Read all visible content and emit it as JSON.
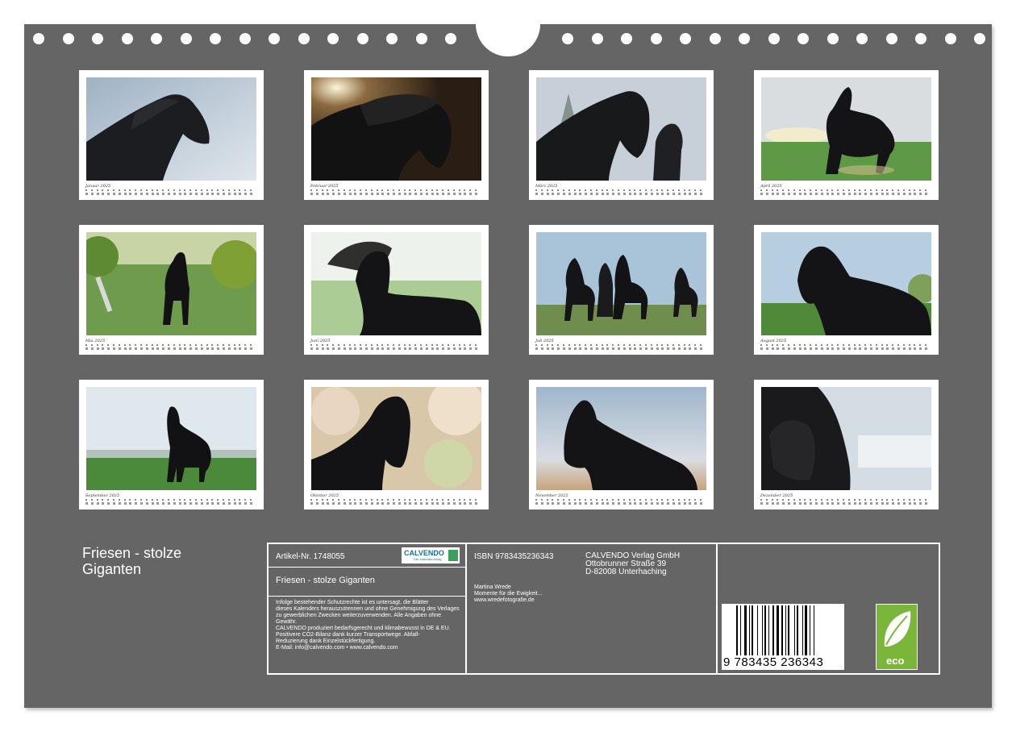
{
  "calendar_title": "Friesen - stolze Giganten",
  "months": [
    "Januar 2025",
    "Februar 2025",
    "März 2025",
    "April 2025",
    "Mai 2025",
    "Juni 2025",
    "Juli 2025",
    "August 2025",
    "September 2025",
    "Oktober 2025",
    "November 2025",
    "Dezember 2025"
  ],
  "info": {
    "article_label": "Artikel-Nr. 1748055",
    "logo_brand": "CALVENDO",
    "logo_tagline": "Der Kalenderverlag",
    "calendar_name": "Friesen - stolze Giganten",
    "legal_text": [
      "Infolge bestehender Schutzrechte ist es untersagt, die Blätter",
      "dieses Kalenders herauszutrennen und ohne Genehmigung des Verlages",
      "zu gewerblichen Zwecken weiterzuverwenden. Alle Angaben ohne",
      "Gewähr.",
      "CALVENDO produziert bedarfsgerecht und klimabewusst in DE & EU.",
      "Positivere CO2-Bilanz dank kurzer Transportwege. Abfall-",
      "Reduzierung dank Einzelstückfertigung.",
      "E-Mail: info@calvendo.com • www.calvendo.com"
    ],
    "isbn": "ISBN 9783435236343",
    "author_lines": [
      "Martina Wrede",
      "Momente für die Ewigkeit...",
      "www.wredefotografie.de"
    ],
    "publisher_lines": [
      "CALVENDO Verlag GmbH",
      "Ottobrunner Straße 39",
      "D-82008 Unterhaching"
    ],
    "barcode_digits": "9 783435 236343",
    "eco_label": "eco"
  }
}
